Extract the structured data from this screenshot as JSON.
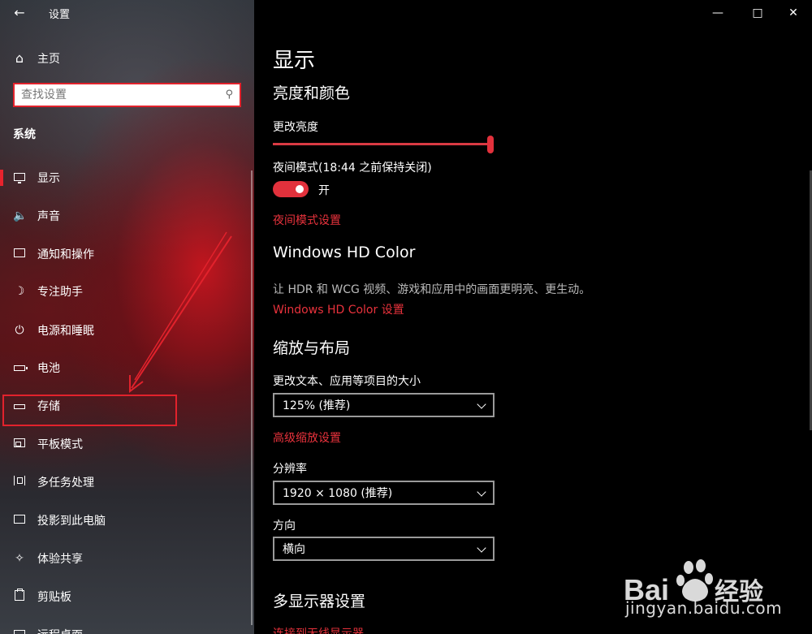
{
  "titlebar": {
    "back_icon": "back-arrow-icon",
    "title": "设置",
    "controls": [
      "minimize-icon",
      "maximize-icon",
      "close-icon"
    ]
  },
  "sidebar": {
    "home_label": "主页",
    "search_placeholder": "查找设置",
    "section_label": "系统",
    "items": [
      {
        "label": "显示",
        "icon": "monitor-icon",
        "active": true
      },
      {
        "label": "声音",
        "icon": "speaker-icon"
      },
      {
        "label": "通知和操作",
        "icon": "notification-icon"
      },
      {
        "label": "专注助手",
        "icon": "moon-icon"
      },
      {
        "label": "电源和睡眠",
        "icon": "power-icon"
      },
      {
        "label": "电池",
        "icon": "battery-icon"
      },
      {
        "label": "存储",
        "icon": "storage-icon",
        "highlighted": true
      },
      {
        "label": "平板模式",
        "icon": "tablet-icon"
      },
      {
        "label": "多任务处理",
        "icon": "multitask-icon"
      },
      {
        "label": "投影到此电脑",
        "icon": "project-icon"
      },
      {
        "label": "体验共享",
        "icon": "share-icon"
      },
      {
        "label": "剪贴板",
        "icon": "clipboard-icon"
      },
      {
        "label": "远程桌面",
        "icon": "remote-desktop-icon"
      }
    ]
  },
  "main": {
    "page_title": "显示",
    "brightness": {
      "heading": "亮度和颜色",
      "slider_label": "更改亮度",
      "slider_value": 100,
      "night_mode_label": "夜间模式(18:44 之前保持关闭)",
      "night_mode_state": "开",
      "night_mode_on": true,
      "night_mode_link": "夜间模式设置"
    },
    "hd_color": {
      "heading": "Windows HD Color",
      "description": "让 HDR 和 WCG 视频、游戏和应用中的画面更明亮、更生动。",
      "link": "Windows HD Color 设置"
    },
    "scale": {
      "heading": "缩放与布局",
      "size_label": "更改文本、应用等项目的大小",
      "size_value": "125% (推荐)",
      "advanced_link": "高级缩放设置",
      "resolution_label": "分辨率",
      "resolution_value": "1920 × 1080 (推荐)",
      "orientation_label": "方向",
      "orientation_value": "横向"
    },
    "multi_display": {
      "heading": "多显示器设置",
      "link": "连接到无线显示器"
    }
  },
  "watermark": {
    "logo": "Bai du 经验",
    "url": "jingyan.baidu.com"
  },
  "colors": {
    "accent": "#e2313c",
    "annotation": "#e2222c",
    "background": "#000000"
  }
}
